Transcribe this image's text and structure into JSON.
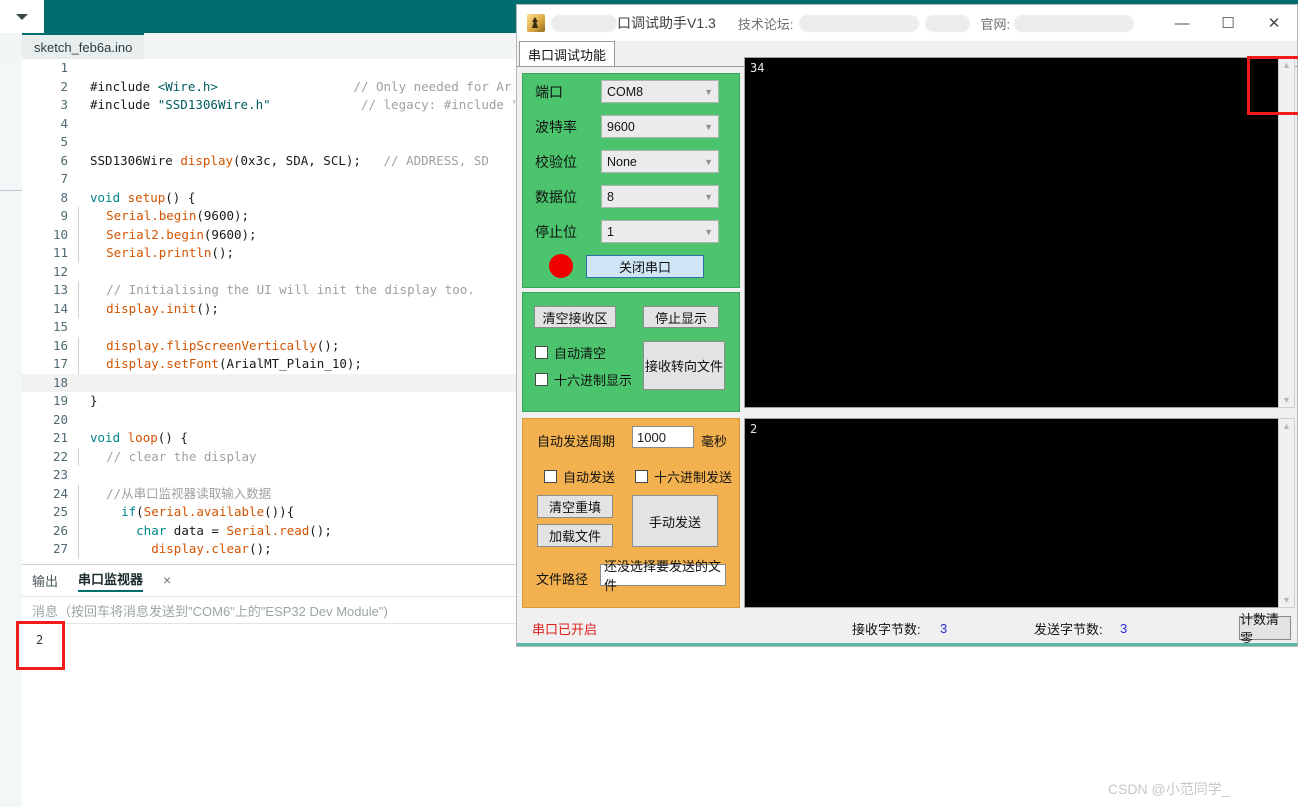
{
  "ide": {
    "board_dropdown_icon": "chevron-down-icon",
    "tab_label": "sketch_feb6a.ino",
    "code_lines": [
      {
        "n": "1",
        "html": ""
      },
      {
        "n": "2",
        "html": "<span class=\"pl\">#include </span><span class=\"str\">&lt;Wire.h&gt;</span>                  <span class=\"cm\">// Only needed for Ar</span>"
      },
      {
        "n": "3",
        "html": "<span class=\"pl\">#include </span><span class=\"str\">\"SSD1306Wire.h\"</span>            <span class=\"cm\">// legacy: #include \"</span>"
      },
      {
        "n": "4",
        "html": ""
      },
      {
        "n": "5",
        "html": ""
      },
      {
        "n": "6",
        "html": "<span class=\"pl\">SSD1306Wire </span><span class=\"fn\">display</span><span class=\"pl\">(0x3c, SDA, SCL);</span>   <span class=\"cm\">// ADDRESS, SD</span>"
      },
      {
        "n": "7",
        "html": ""
      },
      {
        "n": "8",
        "html": "<span class=\"kw\">void </span><span class=\"fn\">setup</span><span class=\"pl\">() {</span>"
      },
      {
        "n": "9",
        "html": "  <span class=\"fn\">Serial.begin</span><span class=\"pl\">(9600);</span>"
      },
      {
        "n": "10",
        "html": "  <span class=\"fn\">Serial2.begin</span><span class=\"pl\">(9600);</span>"
      },
      {
        "n": "11",
        "html": "  <span class=\"fn\">Serial.println</span><span class=\"pl\">();</span>"
      },
      {
        "n": "12",
        "html": ""
      },
      {
        "n": "13",
        "html": "  <span class=\"cm\">// Initialising the UI will init the display too.</span>"
      },
      {
        "n": "14",
        "html": "  <span class=\"fn\">display.init</span><span class=\"pl\">();</span>"
      },
      {
        "n": "15",
        "html": ""
      },
      {
        "n": "16",
        "html": "  <span class=\"fn\">display.flipScreenVertically</span><span class=\"pl\">();</span>"
      },
      {
        "n": "17",
        "html": "  <span class=\"fn\">display.setFont</span><span class=\"pl\">(ArialMT_Plain_10);</span>"
      },
      {
        "n": "18",
        "html": "",
        "hl": true
      },
      {
        "n": "19",
        "html": "<span class=\"pl\">}</span>"
      },
      {
        "n": "20",
        "html": ""
      },
      {
        "n": "21",
        "html": "<span class=\"kw\">void </span><span class=\"fn\">loop</span><span class=\"pl\">() {</span>"
      },
      {
        "n": "22",
        "html": "  <span class=\"cm\">// clear the display</span>"
      },
      {
        "n": "23",
        "html": ""
      },
      {
        "n": "24",
        "html": "  <span class=\"cm\">//从串口监视器读取输入数据</span>"
      },
      {
        "n": "25",
        "html": "    <span class=\"kw\">if</span><span class=\"pl\">(</span><span class=\"fn\">Serial.available</span><span class=\"pl\">()){</span>"
      },
      {
        "n": "26",
        "html": "      <span class=\"kw\">char </span><span class=\"pl\">data = </span><span class=\"fn\">Serial.read</span><span class=\"pl\">();</span>"
      },
      {
        "n": "27",
        "html": "        <span class=\"fn\">display.clear</span><span class=\"pl\">();</span>"
      }
    ],
    "bottom_tabs": [
      {
        "label": "输出",
        "active": false
      },
      {
        "label": "串口监视器",
        "active": true
      }
    ],
    "bottom_tab_close_icon": "×",
    "message_placeholder": "消息（按回车将消息发送到\"COM6\"上的\"ESP32 Dev Module\")",
    "monitor_output": "2",
    "watermark": "CSDN @小范同学_"
  },
  "serial_assistant": {
    "title": "口调试助手V1.3",
    "forum_label": "技术论坛:",
    "site_label": "官网:",
    "app_icon": "serial-tool-icon",
    "window_buttons": {
      "minimize": "—",
      "maximize": "☐",
      "close": "✕"
    },
    "tab_label": "串口调试功能",
    "config": {
      "rows": [
        {
          "label": "端口",
          "value": "COM8",
          "name": "port"
        },
        {
          "label": "波特率",
          "value": "9600",
          "name": "baud"
        },
        {
          "label": "校验位",
          "value": "None",
          "name": "parity"
        },
        {
          "label": "数据位",
          "value": "8",
          "name": "databits"
        },
        {
          "label": "停止位",
          "value": "1",
          "name": "stopbits"
        }
      ],
      "led_status_color": "#f20000",
      "close_port_button": "关闭串口"
    },
    "receive_controls": {
      "clear_rx_button": "清空接收区",
      "stop_display_button": "停止显示",
      "rx_to_file_button": "接收转向文件",
      "auto_clear_checkbox": "自动清空",
      "auto_clear_checked": false,
      "hex_display_checkbox": "十六进制显示",
      "hex_display_checked": false
    },
    "send_controls": {
      "cycle_label": "自动发送周期",
      "cycle_value": "1000",
      "cycle_unit": "毫秒",
      "auto_send_checkbox": "自动发送",
      "auto_send_checked": false,
      "hex_send_checkbox": "十六进制发送",
      "hex_send_checked": false,
      "clear_refill_button": "清空重填",
      "load_file_button": "加载文件",
      "manual_send_button": "手动发送",
      "file_path_label": "文件路径",
      "file_path_value": "还没选择要发送的文件"
    },
    "receive_area_text": "34",
    "send_area_text": "2",
    "scrollbar_up_icon": "chevron-up-icon",
    "scrollbar_down_icon": "chevron-down-icon",
    "status": {
      "port_state": "串口已开启",
      "rx_bytes_label": "接收字节数:",
      "rx_bytes_value": "3",
      "tx_bytes_label": "发送字节数:",
      "tx_bytes_value": "3",
      "reset_count_button": "计数清零"
    }
  }
}
